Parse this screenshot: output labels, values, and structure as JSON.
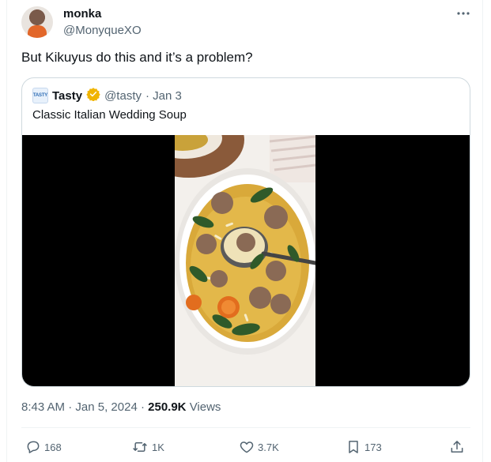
{
  "author": {
    "name": "monka",
    "handle": "@MonyqueXO"
  },
  "tweet": {
    "text": "But Kikuyus do this and it’s a problem?"
  },
  "quoted": {
    "logo_text": "TASTY",
    "name": "Tasty",
    "handle": "@tasty",
    "date": "· Jan 3",
    "text": "Classic Italian Wedding Soup",
    "verified_color": "#f0b400"
  },
  "meta": {
    "time": "8:43 AM",
    "separator": "·",
    "date": "Jan 5, 2024",
    "views_count": "250.9K",
    "views_label": "Views"
  },
  "actions": {
    "replies": "168",
    "reposts": "1K",
    "likes": "3.7K",
    "bookmarks": "173"
  },
  "icons": [
    "more-icon",
    "verified-badge-icon",
    "reply-icon",
    "repost-icon",
    "like-icon",
    "bookmark-icon",
    "share-icon"
  ]
}
